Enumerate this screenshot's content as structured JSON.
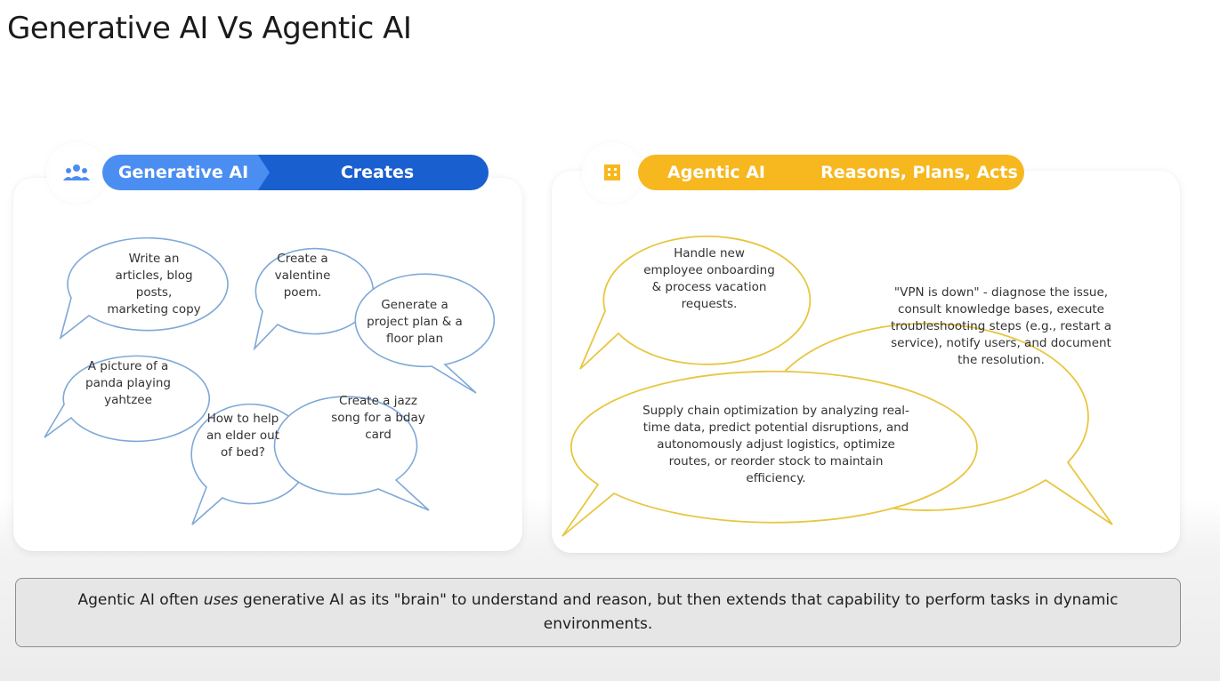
{
  "title": "Generative AI Vs Agentic AI",
  "generative": {
    "label": "Generative AI",
    "verb": "Creates",
    "colors": {
      "light": "#4b8ef1",
      "dark": "#1a5fd0",
      "outline": "#7fa8d8"
    },
    "icon": "people-group-icon",
    "bubbles": [
      "Write an articles, blog posts, marketing copy",
      "Create a valentine poem.",
      "Generate a project plan & a floor plan",
      "A picture of a panda playing yahtzee",
      "How to help an elder out of bed?",
      "Create a jazz song for a bday card"
    ]
  },
  "agentic": {
    "label": "Agentic AI",
    "verb": "Reasons, Plans, Acts",
    "colors": {
      "light": "#f7b71e",
      "dark": "#f2a800",
      "outline": "#e8c640"
    },
    "icon": "building-icon",
    "bubbles": [
      "Handle new employee onboarding & process vacation requests.",
      "\"VPN is down\" - diagnose the issue, consult knowledge bases, execute troubleshooting steps (e.g., restart a service), notify users, and document the resolution.",
      "Supply chain optimization by analyzing real-time data, predict potential disruptions, and autonomously adjust logistics, optimize routes, or reorder stock to maintain efficiency."
    ]
  },
  "footer": {
    "part1": "Agentic AI often ",
    "emphasis": "uses",
    "part2": " generative AI as its \"brain\" to understand and reason, but then extends that capability to perform tasks in dynamic environments."
  }
}
